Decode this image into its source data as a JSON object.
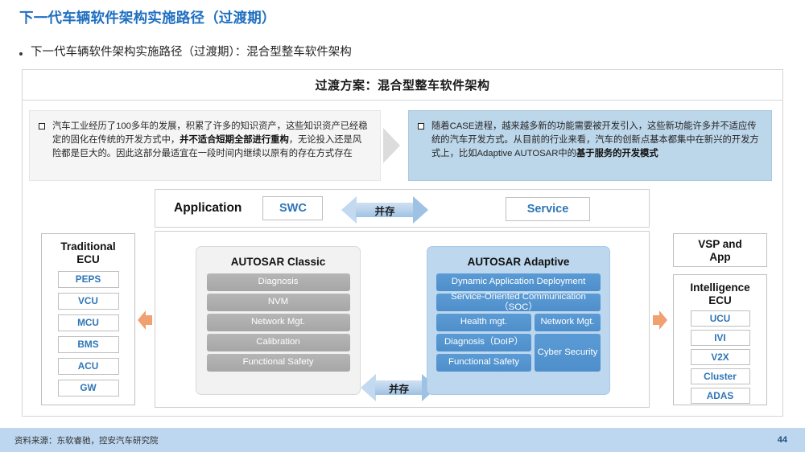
{
  "slide": {
    "title": "下一代车辆软件架构实施路径（过渡期）",
    "bullet": "下一代车辆软件架构实施路径（过渡期）：混合型整车软件架构",
    "panel_header": "过渡方案：混合型整车软件架构"
  },
  "notes": {
    "left": {
      "part1": "汽车工业经历了100多年的发展，积累了许多的知识资产，这些知识资产已经稳定的固化在传统的开发方式中，",
      "bold": "并不适合短期全部进行重构",
      "part2": "，无论投入还是风险都是巨大的。因此这部分最适宜在一段时间内继续以原有的存在方式存在"
    },
    "right": {
      "part1": "随着CASE进程，越来越多新的功能需要被开发引入，这些新功能许多并不适应传统的汽车开发方式。从目前的行业来看，汽车的创新点基本都集中在新兴的开发方式上，比如Adaptive AUTOSAR中的",
      "bold": "基于服务的开发模式",
      "part2": ""
    }
  },
  "app_row": {
    "label": "Application",
    "swc": "SWC",
    "service": "Service",
    "arrow_caption": "并存"
  },
  "middle_arrow_caption": "并存",
  "columns": {
    "traditional": {
      "title": "Traditional\nECU",
      "title_line1": "Traditional",
      "title_line2": "ECU",
      "items": [
        "PEPS",
        "VCU",
        "MCU",
        "BMS",
        "ACU",
        "GW"
      ]
    },
    "vsp": {
      "title_line1": "VSP and",
      "title_line2": "App"
    },
    "intelligence": {
      "title_line1": "Intelligence",
      "title_line2": "ECU",
      "items": [
        "UCU",
        "IVI",
        "V2X",
        "Cluster",
        "ADAS"
      ]
    }
  },
  "stacks": {
    "classic": {
      "title": "AUTOSAR Classic",
      "items": [
        "Diagnosis",
        "NVM",
        "Network Mgt.",
        "Calibration",
        "Functional Safety"
      ]
    },
    "adaptive": {
      "title": "AUTOSAR Adaptive",
      "full_rows": [
        "Dynamic Application Deployment",
        "Service-Oriented Communication（SOC）"
      ],
      "left_items": [
        "Health mgt.",
        "Diagnosis（DoIP）",
        "Functional Safety"
      ],
      "right_items": [
        "Network Mgt.",
        "Cyber Security"
      ]
    }
  },
  "footer": {
    "source": "资料来源：东软睿驰，控安汽车研究院",
    "page": "44"
  },
  "colors": {
    "title_blue": "#1F6FC0",
    "accent_blue": "#2E75B6",
    "adaptive_blue": "#5B9BD5",
    "adaptive_panel": "#BDD7EE",
    "classic_grey": "#A6A6A6",
    "orange": "#F0A071",
    "footer_blue": "#BDD7F0"
  }
}
